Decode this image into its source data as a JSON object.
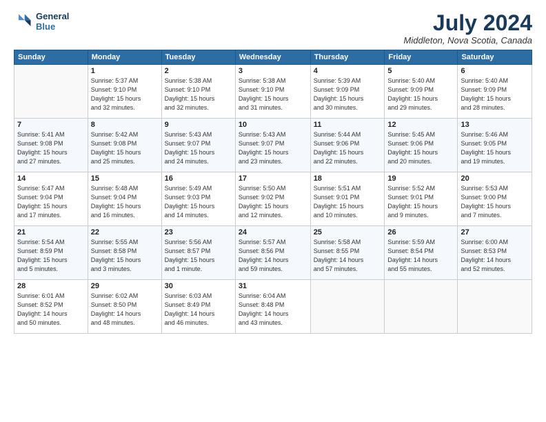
{
  "header": {
    "logo_line1": "General",
    "logo_line2": "Blue",
    "month_title": "July 2024",
    "location": "Middleton, Nova Scotia, Canada"
  },
  "calendar": {
    "days_of_week": [
      "Sunday",
      "Monday",
      "Tuesday",
      "Wednesday",
      "Thursday",
      "Friday",
      "Saturday"
    ],
    "weeks": [
      [
        {
          "day": "",
          "info": ""
        },
        {
          "day": "1",
          "info": "Sunrise: 5:37 AM\nSunset: 9:10 PM\nDaylight: 15 hours\nand 32 minutes."
        },
        {
          "day": "2",
          "info": "Sunrise: 5:38 AM\nSunset: 9:10 PM\nDaylight: 15 hours\nand 32 minutes."
        },
        {
          "day": "3",
          "info": "Sunrise: 5:38 AM\nSunset: 9:10 PM\nDaylight: 15 hours\nand 31 minutes."
        },
        {
          "day": "4",
          "info": "Sunrise: 5:39 AM\nSunset: 9:09 PM\nDaylight: 15 hours\nand 30 minutes."
        },
        {
          "day": "5",
          "info": "Sunrise: 5:40 AM\nSunset: 9:09 PM\nDaylight: 15 hours\nand 29 minutes."
        },
        {
          "day": "6",
          "info": "Sunrise: 5:40 AM\nSunset: 9:09 PM\nDaylight: 15 hours\nand 28 minutes."
        }
      ],
      [
        {
          "day": "7",
          "info": "Sunrise: 5:41 AM\nSunset: 9:08 PM\nDaylight: 15 hours\nand 27 minutes."
        },
        {
          "day": "8",
          "info": "Sunrise: 5:42 AM\nSunset: 9:08 PM\nDaylight: 15 hours\nand 25 minutes."
        },
        {
          "day": "9",
          "info": "Sunrise: 5:43 AM\nSunset: 9:07 PM\nDaylight: 15 hours\nand 24 minutes."
        },
        {
          "day": "10",
          "info": "Sunrise: 5:43 AM\nSunset: 9:07 PM\nDaylight: 15 hours\nand 23 minutes."
        },
        {
          "day": "11",
          "info": "Sunrise: 5:44 AM\nSunset: 9:06 PM\nDaylight: 15 hours\nand 22 minutes."
        },
        {
          "day": "12",
          "info": "Sunrise: 5:45 AM\nSunset: 9:06 PM\nDaylight: 15 hours\nand 20 minutes."
        },
        {
          "day": "13",
          "info": "Sunrise: 5:46 AM\nSunset: 9:05 PM\nDaylight: 15 hours\nand 19 minutes."
        }
      ],
      [
        {
          "day": "14",
          "info": "Sunrise: 5:47 AM\nSunset: 9:04 PM\nDaylight: 15 hours\nand 17 minutes."
        },
        {
          "day": "15",
          "info": "Sunrise: 5:48 AM\nSunset: 9:04 PM\nDaylight: 15 hours\nand 16 minutes."
        },
        {
          "day": "16",
          "info": "Sunrise: 5:49 AM\nSunset: 9:03 PM\nDaylight: 15 hours\nand 14 minutes."
        },
        {
          "day": "17",
          "info": "Sunrise: 5:50 AM\nSunset: 9:02 PM\nDaylight: 15 hours\nand 12 minutes."
        },
        {
          "day": "18",
          "info": "Sunrise: 5:51 AM\nSunset: 9:01 PM\nDaylight: 15 hours\nand 10 minutes."
        },
        {
          "day": "19",
          "info": "Sunrise: 5:52 AM\nSunset: 9:01 PM\nDaylight: 15 hours\nand 9 minutes."
        },
        {
          "day": "20",
          "info": "Sunrise: 5:53 AM\nSunset: 9:00 PM\nDaylight: 15 hours\nand 7 minutes."
        }
      ],
      [
        {
          "day": "21",
          "info": "Sunrise: 5:54 AM\nSunset: 8:59 PM\nDaylight: 15 hours\nand 5 minutes."
        },
        {
          "day": "22",
          "info": "Sunrise: 5:55 AM\nSunset: 8:58 PM\nDaylight: 15 hours\nand 3 minutes."
        },
        {
          "day": "23",
          "info": "Sunrise: 5:56 AM\nSunset: 8:57 PM\nDaylight: 15 hours\nand 1 minute."
        },
        {
          "day": "24",
          "info": "Sunrise: 5:57 AM\nSunset: 8:56 PM\nDaylight: 14 hours\nand 59 minutes."
        },
        {
          "day": "25",
          "info": "Sunrise: 5:58 AM\nSunset: 8:55 PM\nDaylight: 14 hours\nand 57 minutes."
        },
        {
          "day": "26",
          "info": "Sunrise: 5:59 AM\nSunset: 8:54 PM\nDaylight: 14 hours\nand 55 minutes."
        },
        {
          "day": "27",
          "info": "Sunrise: 6:00 AM\nSunset: 8:53 PM\nDaylight: 14 hours\nand 52 minutes."
        }
      ],
      [
        {
          "day": "28",
          "info": "Sunrise: 6:01 AM\nSunset: 8:52 PM\nDaylight: 14 hours\nand 50 minutes."
        },
        {
          "day": "29",
          "info": "Sunrise: 6:02 AM\nSunset: 8:50 PM\nDaylight: 14 hours\nand 48 minutes."
        },
        {
          "day": "30",
          "info": "Sunrise: 6:03 AM\nSunset: 8:49 PM\nDaylight: 14 hours\nand 46 minutes."
        },
        {
          "day": "31",
          "info": "Sunrise: 6:04 AM\nSunset: 8:48 PM\nDaylight: 14 hours\nand 43 minutes."
        },
        {
          "day": "",
          "info": ""
        },
        {
          "day": "",
          "info": ""
        },
        {
          "day": "",
          "info": ""
        }
      ]
    ]
  }
}
